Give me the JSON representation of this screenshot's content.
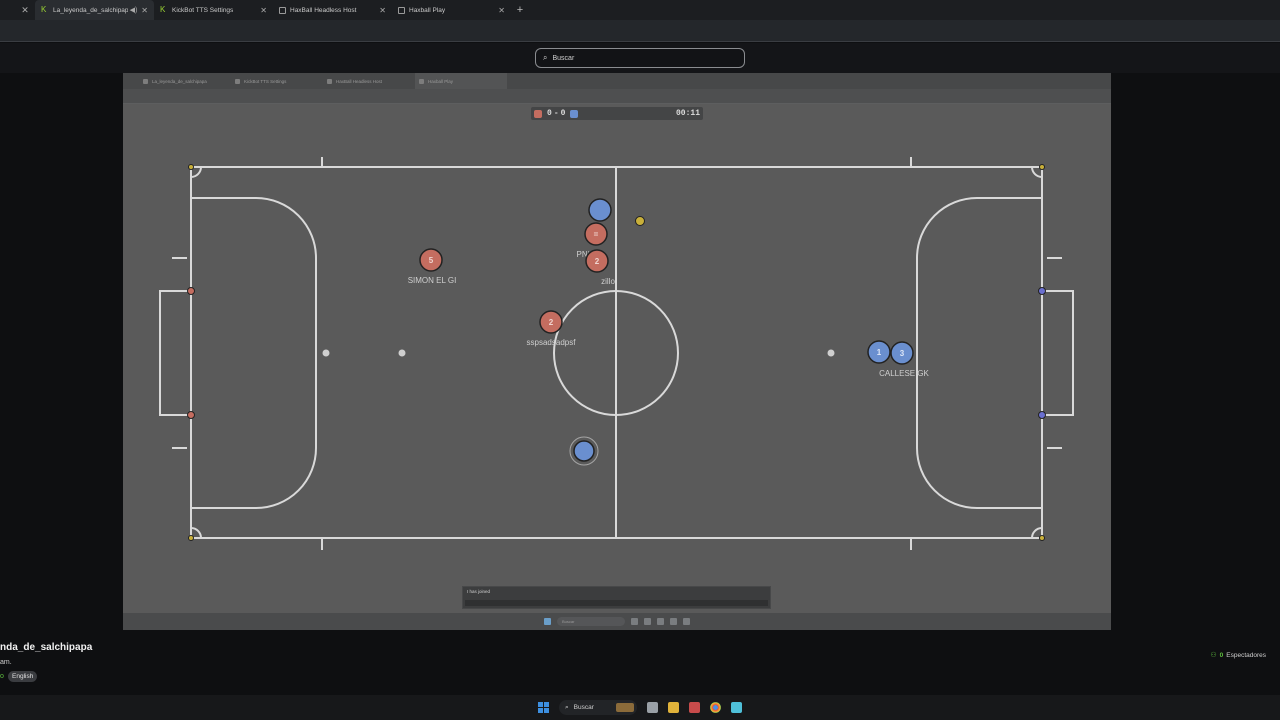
{
  "browser": {
    "tabs": [
      {
        "title": "La_leyenda_de_salchipapa",
        "active": true,
        "icon": "kick-icon"
      },
      {
        "title": "KickBot TTS Settings",
        "active": false,
        "icon": "kick-icon"
      },
      {
        "title": "HaxBall Headless Host",
        "active": false,
        "icon": "page-icon"
      },
      {
        "title": "Haxball Play",
        "active": false,
        "icon": "page-icon"
      }
    ],
    "search_placeholder": "Buscar"
  },
  "stream": {
    "inner_tabs": [
      "La_leyenda_de_salchipapa",
      "KickBot TTS Settings",
      "HaxBall Headless Host",
      "Haxball Play"
    ],
    "scoreboard": {
      "red_score": "0",
      "separator": "-",
      "blue_score": "0",
      "time": "00:11"
    },
    "players": [
      {
        "team": "red",
        "number": "5",
        "name": "SIMON EL GI"
      },
      {
        "team": "red",
        "number": "2",
        "name": "sspsadsadpsf"
      },
      {
        "team": "red",
        "number": "=",
        "name": "PNi"
      },
      {
        "team": "red",
        "number": "2",
        "name": "zillo"
      },
      {
        "team": "blue",
        "number": "",
        "name": ""
      },
      {
        "team": "blue",
        "number": "1",
        "name": ""
      },
      {
        "team": "blue",
        "number": "3",
        "name": "CALLESE GK"
      },
      {
        "team": "blue",
        "number": "",
        "name": ""
      }
    ],
    "chat": {
      "line1": "",
      "line2": "I has joined"
    },
    "inner_taskbar_search": "Buscar"
  },
  "channel": {
    "name": "nda_de_salchipapa",
    "subtitle": "am.",
    "language": "English",
    "spectators_count": "0",
    "spectators_label": "Espectadores"
  },
  "taskbar": {
    "search": "Buscar"
  },
  "colors": {
    "red_team": "#c46d60",
    "blue_team": "#6a8fcf",
    "ball": "#c9b03a",
    "kick_green": "#53fc18"
  }
}
